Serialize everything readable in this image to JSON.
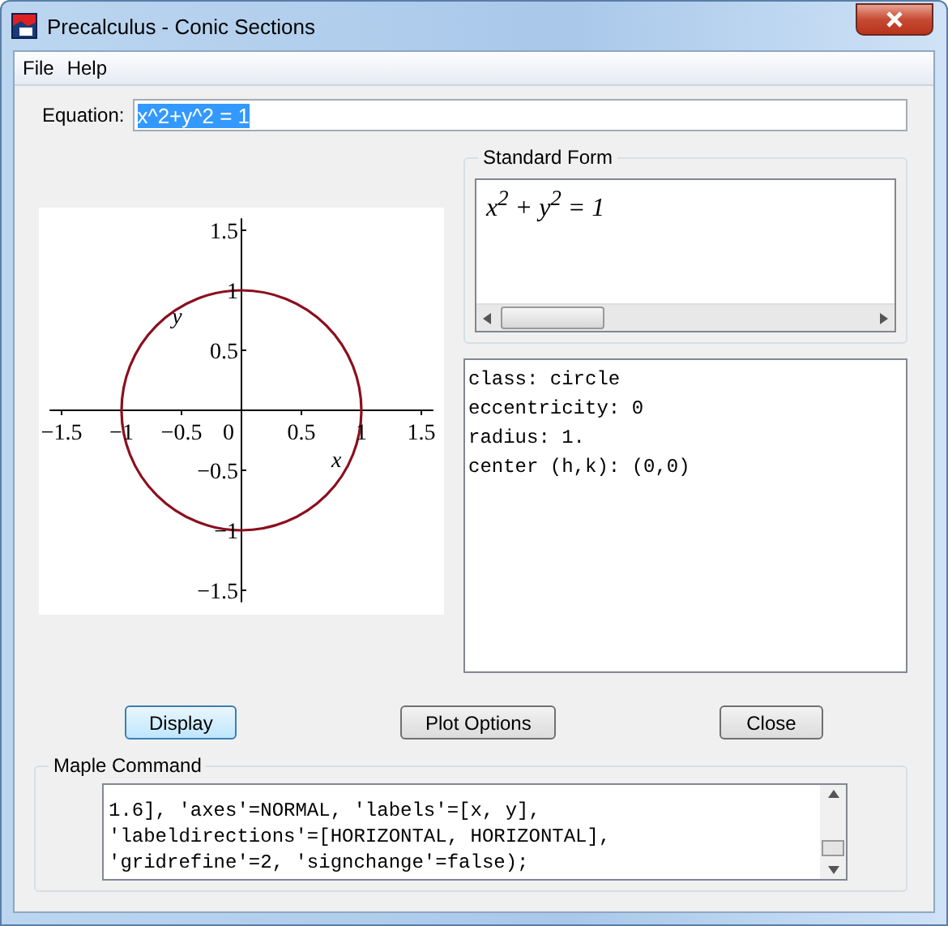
{
  "window": {
    "title": "Precalculus - Conic Sections"
  },
  "menu": [
    "File",
    "Help"
  ],
  "equation": {
    "label": "Equation:",
    "value": "x^2+y^2 = 1",
    "text_selected": true
  },
  "plot": {
    "xlabel": "x",
    "ylabel": "y",
    "x_tick_labels": [
      "−1.5",
      "−1",
      "−0.5",
      "0",
      "0.5",
      "1",
      "1.5"
    ],
    "y_tick_labels": [
      "1.5",
      "1",
      "0.5",
      "−0.5",
      "−1",
      "−1.5"
    ]
  },
  "standard_form": {
    "title": "Standard Form",
    "formula": "x$^{2}$ + y$^{2}$ = 1"
  },
  "info_lines": [
    "class: circle",
    "eccentricity: 0",
    "radius: 1.",
    "center (h,k): (0,0)"
  ],
  "buttons": [
    {
      "label": "Display",
      "focused": true
    },
    {
      "label": "Plot Options",
      "focused": false
    },
    {
      "label": "Close",
      "focused": false
    }
  ],
  "maple_command": {
    "title": "Maple Command",
    "lines": [
      "1.6], 'axes'=NORMAL, 'labels'=[x, y],",
      "'labeldirections'=[HORIZONTAL, HORIZONTAL],",
      "'gridrefine'=2, 'signchange'=false);"
    ]
  }
}
